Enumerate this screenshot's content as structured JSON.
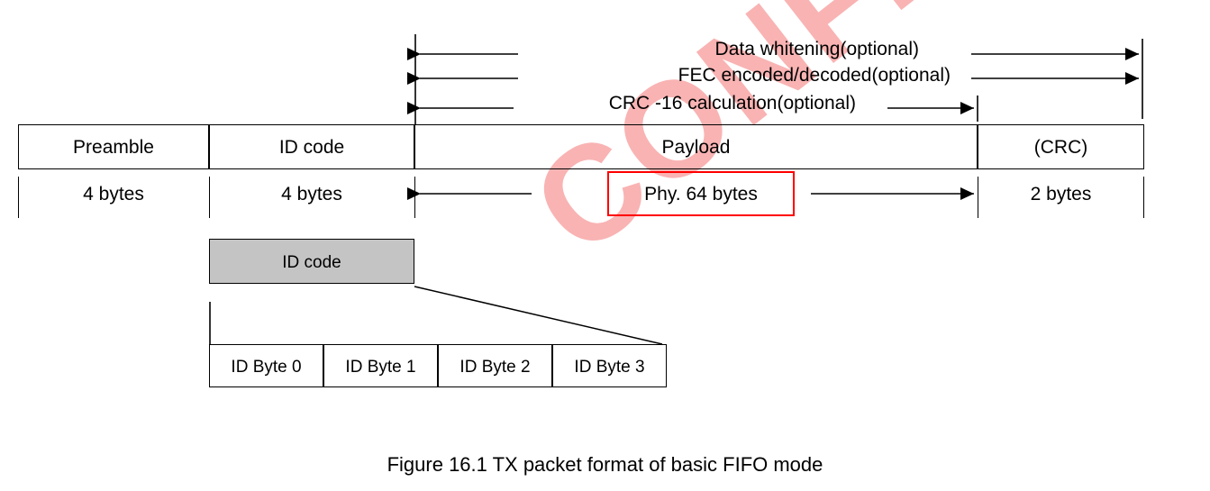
{
  "figure": {
    "caption": "Figure 16.1 TX packet format of basic FIFO mode",
    "watermark": "CONFIDENTIAL",
    "watermark_color": "#f9b3b3"
  },
  "annotations": [
    {
      "label": "Data whitening(optional)"
    },
    {
      "label": "FEC encoded/decoded(optional)"
    },
    {
      "label": "CRC -16 calculation(optional)"
    }
  ],
  "packet": {
    "fields": [
      {
        "name": "Preamble",
        "size": "4 bytes"
      },
      {
        "name": "ID code",
        "size": "4 bytes"
      },
      {
        "name": "Payload",
        "size": "Phy. 64 bytes"
      },
      {
        "name": "(CRC)",
        "size": "2 bytes"
      }
    ]
  },
  "highlight": {
    "text": "Phy. 64 bytes",
    "color": "#ff0000"
  },
  "id_code_detail": {
    "title": "ID code",
    "fill_color": "#c4c4c4",
    "bytes": [
      {
        "label": "ID Byte 0"
      },
      {
        "label": "ID Byte 1"
      },
      {
        "label": "ID Byte 2"
      },
      {
        "label": "ID Byte 3"
      }
    ]
  }
}
